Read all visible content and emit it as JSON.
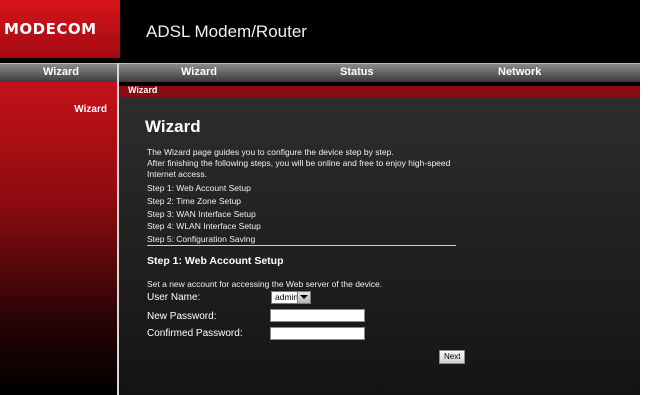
{
  "header": {
    "logo": "MODECOM",
    "title": "ADSL Modem/Router"
  },
  "nav": {
    "left_label": "Wizard",
    "items": [
      "Wizard",
      "Status",
      "Network"
    ]
  },
  "sidebar": {
    "items": [
      "Wizard"
    ]
  },
  "breadcrumb": "Wizard",
  "main": {
    "title": "Wizard",
    "intro": [
      "The Wizard page guides you to configure the device step by step.",
      "After finishing the following steps, you will be online and free to enjoy high-speed",
      "Internet access."
    ],
    "steps": [
      "Step 1: Web Account Setup",
      "Step 2: Time Zone Setup",
      "Step 3: WAN Interface Setup",
      "Step 4: WLAN Interface Setup",
      "Step 5: Configuration Saving"
    ],
    "section_title": "Step 1: Web Account Setup",
    "section_desc": "Set a new account for accessing the Web server of the device.",
    "form": {
      "username_label": "User Name:",
      "username_value": "admin",
      "new_password_label": "New Password:",
      "new_password_value": "",
      "confirm_password_label": "Confirmed Password:",
      "confirm_password_value": ""
    },
    "next_label": "Next"
  },
  "colors": {
    "brand_red": "#d8131b",
    "dark_red": "#8a0b10",
    "background": "#000000"
  }
}
